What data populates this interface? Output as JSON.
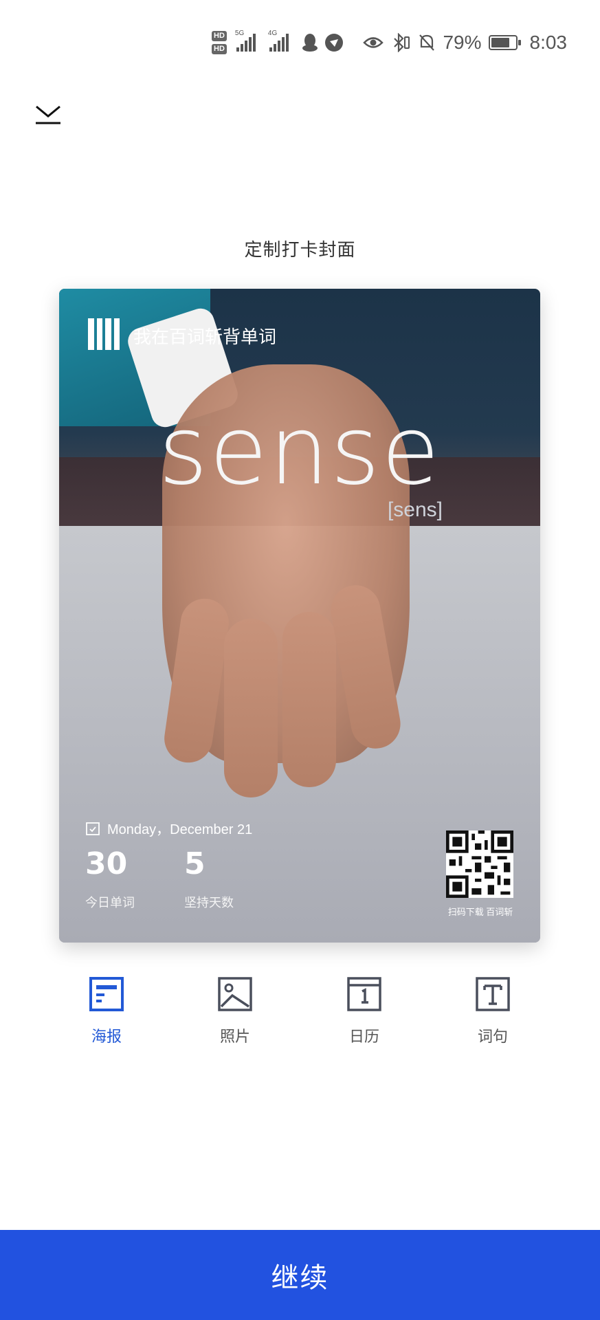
{
  "status_bar": {
    "time": "8:03",
    "battery_percent": "79%",
    "battery_level": 0.79,
    "hd1": "HD",
    "hd2": "HD",
    "net1": "5G",
    "net2": "4G"
  },
  "page": {
    "title": "定制打卡封面"
  },
  "card": {
    "brand_text": "我在百词斩背单词",
    "word": "sense",
    "phonetic": "[sens]",
    "date": "Monday，December 21",
    "stats": [
      {
        "value": "30",
        "label": "今日单词"
      },
      {
        "value": "5",
        "label": "坚持天数"
      }
    ],
    "qr_caption": "扫码下载 百词斩"
  },
  "tabs": [
    {
      "label": "海报",
      "icon": "poster-icon",
      "active": true
    },
    {
      "label": "照片",
      "icon": "photo-icon",
      "active": false
    },
    {
      "label": "日历",
      "icon": "calendar-icon",
      "active": false
    },
    {
      "label": "词句",
      "icon": "text-icon",
      "active": false
    }
  ],
  "colors": {
    "accent": "#2252e0",
    "active_tab": "#2259d6",
    "inactive_tab": "#4a4f5c"
  },
  "continue_button": {
    "label": "继续"
  }
}
